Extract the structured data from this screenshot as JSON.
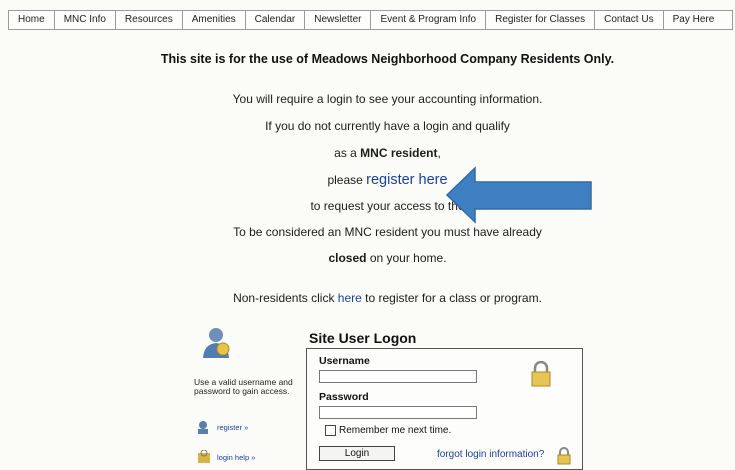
{
  "nav": [
    "Home",
    "MNC Info",
    "Resources",
    "Amenities",
    "Calendar",
    "Newsletter",
    "Event & Program Info",
    "Register for Classes",
    "Contact Us",
    "Pay Here"
  ],
  "headline": "This site is for the use of Meadows Neighborhood Company Residents Only.",
  "text": {
    "line1": "You will require a login to see your accounting information.",
    "line2": "If you do not currently have a login and qualify",
    "line3_pre": "as a ",
    "line3_bold": "MNC resident",
    "line3_post": ",",
    "line4_pre": "please ",
    "line4_link": "register here",
    "line5": "to request your access to the",
    "line6": "To be considered an MNC resident you must have already",
    "line7_bold": "closed",
    "line7_post": " on your home.",
    "line8_pre": "Non-residents click ",
    "line8_link": "here",
    "line8_post": " to register for a class or program."
  },
  "logon": {
    "title": "Site User Logon",
    "help": "Use a valid username and password to gain access.",
    "register_link": "register »",
    "login_help_link": "login help »",
    "username_label": "Username",
    "username_value": "",
    "password_label": "Password",
    "password_value": "",
    "remember_label": "Remember me next time.",
    "remember_checked": false,
    "login_button": "Login",
    "forgot_link": "forgot login information?"
  },
  "colors": {
    "link": "#1a3fa6",
    "arrow": "#3f80c3"
  },
  "icons": [
    "user-avatar-icon",
    "register-icon",
    "login-help-icon",
    "lock-icon",
    "lock-small-icon",
    "arrow-annotation"
  ]
}
